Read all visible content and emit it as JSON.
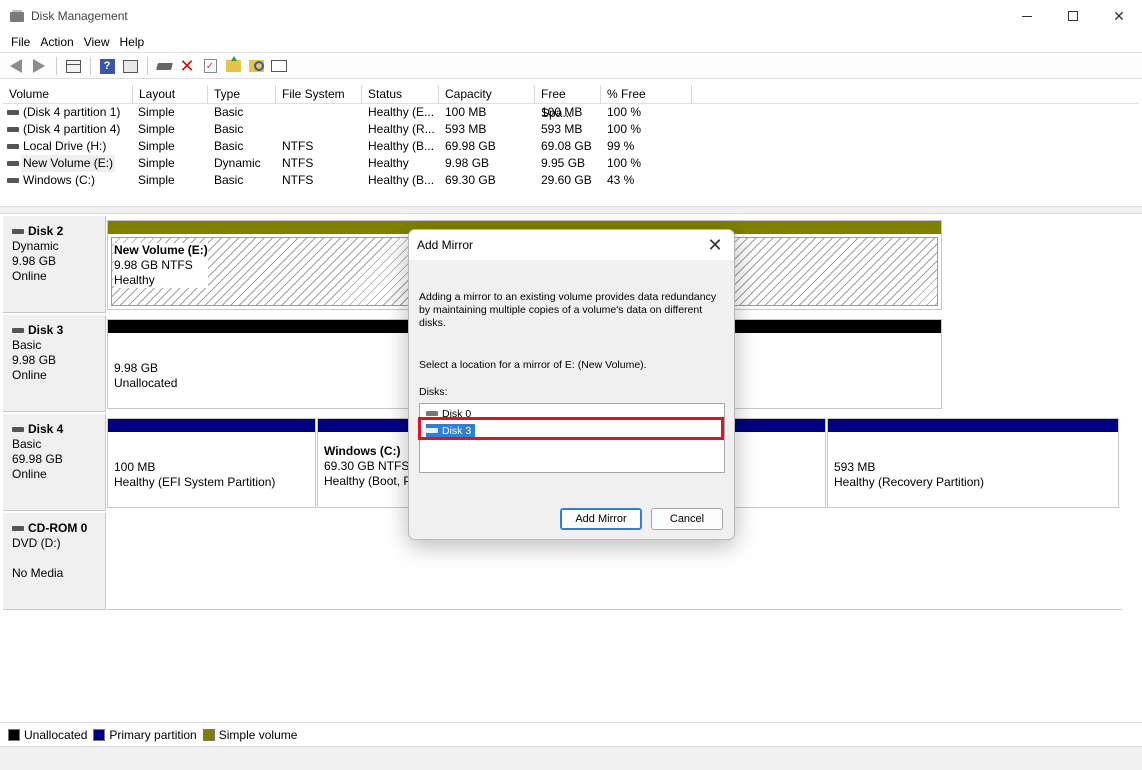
{
  "window": {
    "title": "Disk Management"
  },
  "menu": [
    "File",
    "Action",
    "View",
    "Help"
  ],
  "volume_list": {
    "columns": [
      "Volume",
      "Layout",
      "Type",
      "File System",
      "Status",
      "Capacity",
      "Free Spa...",
      "% Free"
    ],
    "rows": [
      {
        "volume": "(Disk 4 partition 1)",
        "layout": "Simple",
        "type": "Basic",
        "fs": "",
        "status": "Healthy (E...",
        "capacity": "100 MB",
        "free": "100 MB",
        "pct": "100 %"
      },
      {
        "volume": "(Disk 4 partition 4)",
        "layout": "Simple",
        "type": "Basic",
        "fs": "",
        "status": "Healthy (R...",
        "capacity": "593 MB",
        "free": "593 MB",
        "pct": "100 %"
      },
      {
        "volume": "Local Drive (H:)",
        "layout": "Simple",
        "type": "Basic",
        "fs": "NTFS",
        "status": "Healthy (B...",
        "capacity": "69.98 GB",
        "free": "69.08 GB",
        "pct": "99 %"
      },
      {
        "volume": "New Volume (E:)",
        "layout": "Simple",
        "type": "Dynamic",
        "fs": "NTFS",
        "status": "Healthy",
        "capacity": "9.98 GB",
        "free": "9.95 GB",
        "pct": "100 %"
      },
      {
        "volume": "Windows (C:)",
        "layout": "Simple",
        "type": "Basic",
        "fs": "NTFS",
        "status": "Healthy (B...",
        "capacity": "69.30 GB",
        "free": "29.60 GB",
        "pct": "43 %"
      }
    ]
  },
  "disks": {
    "disk2": {
      "name": "Disk 2",
      "type": "Dynamic",
      "size": "9.98 GB",
      "state": "Online",
      "part": {
        "title": "New Volume  (E:)",
        "line1": "9.98 GB NTFS",
        "line2": "Healthy"
      }
    },
    "disk3": {
      "name": "Disk 3",
      "type": "Basic",
      "size": "9.98 GB",
      "state": "Online",
      "part": {
        "line1": "9.98 GB",
        "line2": "Unallocated"
      }
    },
    "disk4": {
      "name": "Disk 4",
      "type": "Basic",
      "size": "69.98 GB",
      "state": "Online",
      "p1": {
        "line1": "100 MB",
        "line2": "Healthy (EFI System Partition)"
      },
      "p2": {
        "title": "Windows  (C:)",
        "line1": "69.30 GB NTFS",
        "line2": "Healthy (Boot, P"
      },
      "p4": {
        "line1": "593 MB",
        "line2": "Healthy (Recovery Partition)"
      }
    },
    "cdrom": {
      "name": "CD-ROM 0",
      "type": "DVD (D:)",
      "state": "No Media"
    }
  },
  "legend": {
    "unallocated": "Unallocated",
    "primary": "Primary partition",
    "simple": "Simple volume",
    "colors": {
      "unallocated": "#000000",
      "primary": "#000080",
      "simple": "#808000"
    }
  },
  "dialog": {
    "title": "Add Mirror",
    "description": "Adding a mirror to an existing volume provides data redundancy by maintaining multiple copies of a volume's data on different disks.",
    "prompt": "Select a location for a mirror of E: (New Volume).",
    "disks_label": "Disks:",
    "disks": [
      "Disk 0",
      "Disk 3"
    ],
    "selected_disk": "Disk 3",
    "add_button": "Add Mirror",
    "cancel_button": "Cancel"
  }
}
